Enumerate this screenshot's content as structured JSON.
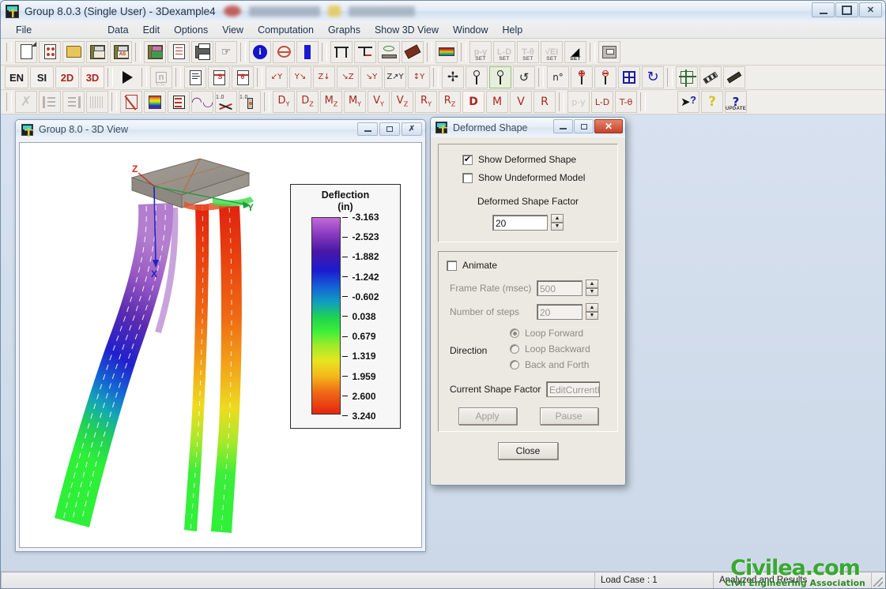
{
  "window": {
    "title": "Group 8.0.3 (Single User) - 3Dexample4",
    "app_icon": "group-app-icon",
    "buttons": {
      "minimize": "–",
      "maximize": "□",
      "close": "✕"
    }
  },
  "menubar": {
    "items": [
      {
        "label": "File"
      },
      {
        "label": "Data"
      },
      {
        "label": "Edit"
      },
      {
        "label": "Options"
      },
      {
        "label": "View"
      },
      {
        "label": "Computation"
      },
      {
        "label": "Graphs"
      },
      {
        "label": "Show 3D View"
      },
      {
        "label": "Window"
      },
      {
        "label": "Help"
      }
    ]
  },
  "toolbar1": {
    "buttons": [
      {
        "name": "new-file-icon"
      },
      {
        "name": "new-from-template-icon"
      },
      {
        "name": "open-file-icon"
      },
      {
        "name": "save-icon"
      },
      {
        "name": "save-as-icon"
      },
      {
        "name": "save-graphics-icon"
      },
      {
        "name": "report-icon"
      },
      {
        "name": "print-icon"
      },
      {
        "name": "export-icon"
      },
      {
        "name": "project-info-icon"
      },
      {
        "name": "pile-section-icon"
      },
      {
        "name": "pile-icon"
      },
      {
        "name": "pile-cap-icon"
      },
      {
        "name": "pile-batter-icon"
      },
      {
        "name": "soil-layer-icon"
      },
      {
        "name": "soil-properties-icon"
      },
      {
        "name": "soil-profile-icon"
      }
    ],
    "set_buttons": [
      {
        "label": "p-y",
        "sub": "SET",
        "disabled": true
      },
      {
        "label": "L-D",
        "sub": "SET",
        "disabled": true
      },
      {
        "label": "T-θ",
        "sub": "SET",
        "disabled": true
      },
      {
        "label": "√EI",
        "sub": "SET",
        "disabled": true
      },
      {
        "label": "◢",
        "sub": "SET",
        "disabled": false
      }
    ],
    "tail": [
      {
        "name": "print-preview-icon"
      }
    ]
  },
  "toolbar2": {
    "text_buttons": [
      {
        "label": "EN",
        "style": "black",
        "active": false
      },
      {
        "label": "SI",
        "style": "black",
        "active": false
      },
      {
        "label": "2D",
        "style": "red",
        "active": false
      },
      {
        "label": "3D",
        "style": "red",
        "active": true
      }
    ],
    "run_button": {
      "name": "run-analysis-icon"
    },
    "buttons": [
      {
        "name": "load-case-icon",
        "disabled": true
      },
      {
        "name": "text-output-icon"
      },
      {
        "name": "summary-output-icon"
      },
      {
        "name": "settings-output-icon"
      },
      {
        "name": "view-xy-icon"
      },
      {
        "name": "view-yx-icon"
      },
      {
        "name": "view-zx-icon"
      },
      {
        "name": "view-xz-icon"
      },
      {
        "name": "view-zy-icon"
      },
      {
        "name": "view-iso-icon"
      },
      {
        "name": "view-rotate-axes-icon"
      },
      {
        "name": "pan-icon"
      },
      {
        "name": "zoom-window-icon"
      },
      {
        "name": "zoom-selected-icon",
        "selected": true
      },
      {
        "name": "rotate-view-icon"
      },
      {
        "name": "zoom-scale-icon"
      },
      {
        "name": "zoom-in-icon"
      },
      {
        "name": "zoom-out-icon"
      },
      {
        "name": "zoom-fit-icon"
      },
      {
        "name": "refresh-view-icon"
      },
      {
        "name": "grid-toggle-icon"
      },
      {
        "name": "measure-icon"
      },
      {
        "name": "scale-ruler-icon"
      }
    ]
  },
  "toolbar3": {
    "buttons": [
      {
        "name": "clear-selection-icon",
        "disabled": true
      },
      {
        "name": "align-left-icon",
        "disabled": true
      },
      {
        "name": "align-right-icon",
        "disabled": true
      },
      {
        "name": "distribute-icon",
        "disabled": true
      },
      {
        "name": "graph-plot-icon"
      },
      {
        "name": "contour-color-icon"
      },
      {
        "name": "table-output-icon"
      },
      {
        "name": "pile-group-icon"
      },
      {
        "name": "pile-load-icon"
      },
      {
        "name": "single-pile-icon"
      }
    ],
    "result_buttons": [
      {
        "label": "D",
        "sub": "Y"
      },
      {
        "label": "D",
        "sub": "Z"
      },
      {
        "label": "M",
        "sub": "Z"
      },
      {
        "label": "M",
        "sub": "Y"
      },
      {
        "label": "V",
        "sub": "Y"
      },
      {
        "label": "V",
        "sub": "Z"
      },
      {
        "label": "R",
        "sub": "Y"
      },
      {
        "label": "R",
        "sub": "Z"
      },
      {
        "label": "D",
        "sub": "",
        "active": true
      },
      {
        "label": "M",
        "sub": ""
      },
      {
        "label": "V",
        "sub": ""
      },
      {
        "label": "R",
        "sub": ""
      }
    ],
    "curve_buttons": [
      {
        "label": "p-y",
        "disabled": true
      },
      {
        "label": "L-D",
        "disabled": false
      },
      {
        "label": "T-θ",
        "disabled": false
      }
    ],
    "help_buttons": [
      {
        "name": "context-help-icon"
      },
      {
        "name": "help-icon"
      },
      {
        "name": "check-update-icon",
        "sub": "UPDATE"
      }
    ]
  },
  "view3d": {
    "title": "Group 8.0 - 3D View",
    "buttons": {
      "minimize": "–",
      "maximize": "□",
      "close": "✕"
    },
    "axes": [
      {
        "label": "Z",
        "color": "#cc2b1a"
      },
      {
        "label": "X",
        "color": "#2222c8"
      },
      {
        "label": "Y",
        "color": "#1f9e36"
      }
    ]
  },
  "legend": {
    "title_line1": "Deflection",
    "title_line2": "(in)",
    "ticks": [
      "-3.163",
      "-2.523",
      "-1.882",
      "-1.242",
      "-0.602",
      "0.038",
      "0.679",
      "1.319",
      "1.959",
      "2.600",
      "3.240"
    ]
  },
  "chart_data": {
    "type": "heatmap",
    "title": "Deflection (in)",
    "unit": "in",
    "colorbar_min": -3.163,
    "colorbar_max": 3.24,
    "colorbar_ticks": [
      -3.163,
      -2.523,
      -1.882,
      -1.242,
      -0.602,
      0.038,
      0.679,
      1.319,
      1.959,
      2.6,
      3.24
    ],
    "colormap": [
      "#c36ad8",
      "#8b3cc0",
      "#4b17a6",
      "#1c1ccf",
      "#1660d6",
      "#0f9ec0",
      "#1fd44f",
      "#3ef03b",
      "#9ceb2a",
      "#e8e520",
      "#f4b61a",
      "#ef6a16",
      "#e5240f"
    ],
    "description": "3D deformed shape of a battered pile group with rigid pile cap; deflection contour rendered on pile elements",
    "deformed_shape_factor": 20,
    "legend_position": "right"
  },
  "dialog": {
    "title": "Deformed Shape",
    "buttons": {
      "minimize": "–",
      "maximize": "□",
      "close": "✕"
    },
    "show_deformed_shape": {
      "label": "Show Deformed Shape",
      "checked": true
    },
    "show_undeformed_model": {
      "label": "Show Undeformed Model",
      "checked": false
    },
    "deformed_shape_factor": {
      "label": "Deformed Shape Factor",
      "value": "20"
    },
    "animate": {
      "label": "Animate",
      "checked": false
    },
    "frame_rate": {
      "label": "Frame Rate (msec)",
      "value": "500"
    },
    "number_of_steps": {
      "label": "Number of steps",
      "value": "20"
    },
    "direction": {
      "label": "Direction",
      "options": [
        {
          "label": "Loop Forward",
          "selected": true
        },
        {
          "label": "Loop Backward",
          "selected": false
        },
        {
          "label": "Back and Forth",
          "selected": false
        }
      ]
    },
    "current_shape_factor": {
      "label": "Current Shape Factor",
      "value": "EditCurrentF"
    },
    "apply_button": {
      "label": "Apply",
      "disabled": true
    },
    "pause_button": {
      "label": "Pause",
      "disabled": true
    },
    "close_button": {
      "label": "Close",
      "disabled": false
    }
  },
  "statusbar": {
    "load_case": "Load Case : 1",
    "status": "Analyzed and Results"
  },
  "watermark": {
    "line1": "Civilea.com",
    "line2": "Civil Engineering Association"
  }
}
